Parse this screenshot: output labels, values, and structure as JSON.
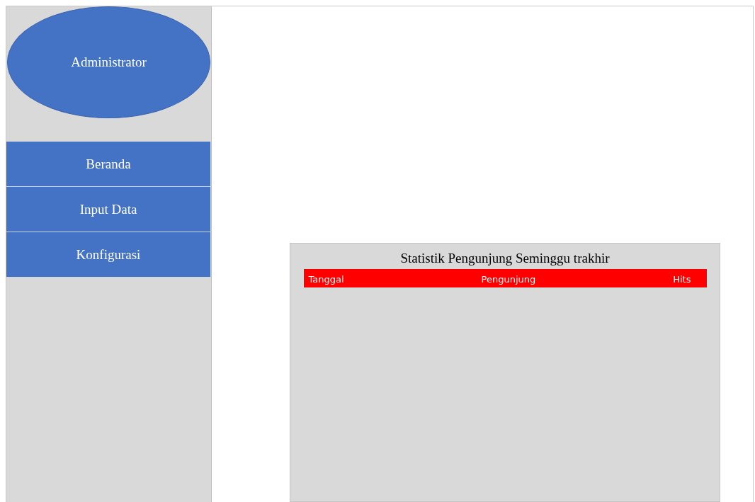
{
  "profile": {
    "label": "Administrator"
  },
  "menu": [
    {
      "label": "Beranda"
    },
    {
      "label": "Input Data"
    },
    {
      "label": "Konfigurasi"
    }
  ],
  "stats_panel": {
    "title": "Statistik Pengunjung Seminggu trakhir",
    "columns": [
      "Tanggal",
      "Pengunjung",
      "Hits"
    ]
  }
}
